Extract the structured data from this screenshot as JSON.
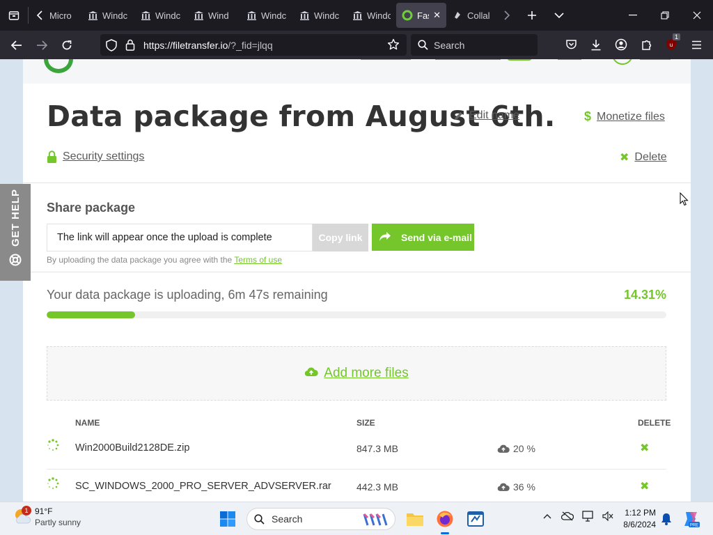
{
  "browser": {
    "tabs": [
      {
        "title": "Micro",
        "icon": "back-chevron",
        "active": false
      },
      {
        "title": "Windc",
        "icon": "columns-icon",
        "active": false
      },
      {
        "title": "Windc",
        "icon": "columns-icon",
        "active": false
      },
      {
        "title": "Wind",
        "icon": "columns-icon",
        "active": false
      },
      {
        "title": "Windc",
        "icon": "columns-icon",
        "active": false
      },
      {
        "title": "Windc",
        "icon": "columns-icon",
        "active": false
      },
      {
        "title": "Windc",
        "icon": "columns-icon",
        "active": false
      },
      {
        "title": "Fas",
        "icon": "filetransfer-icon",
        "active": true
      },
      {
        "title": "Collal",
        "icon": "collab-icon",
        "active": false
      }
    ],
    "url_main": "https://filetransfer.io",
    "url_rest": "/?_fid=jlqq",
    "search_placeholder": "Search",
    "extension_badge": "1"
  },
  "page": {
    "title": "Data package from August 6th.",
    "edit_name": "Edit name",
    "monetize": "Monetize files",
    "security": "Security settings",
    "delete": "Delete",
    "share_heading": "Share package",
    "link_placeholder": "The link will appear once the upload is complete",
    "copy_link": "Copy link",
    "send_email": "Send via e-mail",
    "terms_prefix": "By uploading the data package you agree with the ",
    "terms_link": "Terms of use",
    "upload_status": "Your data package is uploading, 6m 47s remaining",
    "upload_percent": "14.31%",
    "upload_fraction": 0.1431,
    "add_more": "Add more files",
    "get_help": "GET HELP",
    "columns": {
      "name": "NAME",
      "size": "SIZE",
      "delete": "DELETE"
    },
    "files": [
      {
        "name": "Win2000Build2128DE.zip",
        "size": "847.3 MB",
        "progress": "20 %"
      },
      {
        "name": "SC_WINDOWS_2000_PRO_SERVER_ADVSERVER.rar",
        "size": "442.3 MB",
        "progress": "36 %"
      }
    ]
  },
  "taskbar": {
    "weather_temp": "91°F",
    "weather_cond": "Partly sunny",
    "weather_badge": "1",
    "search": "Search",
    "time": "1:12 PM",
    "date": "8/6/2024"
  },
  "colors": {
    "accent": "#74c62a",
    "chrome_dark": "#1c1b22"
  }
}
